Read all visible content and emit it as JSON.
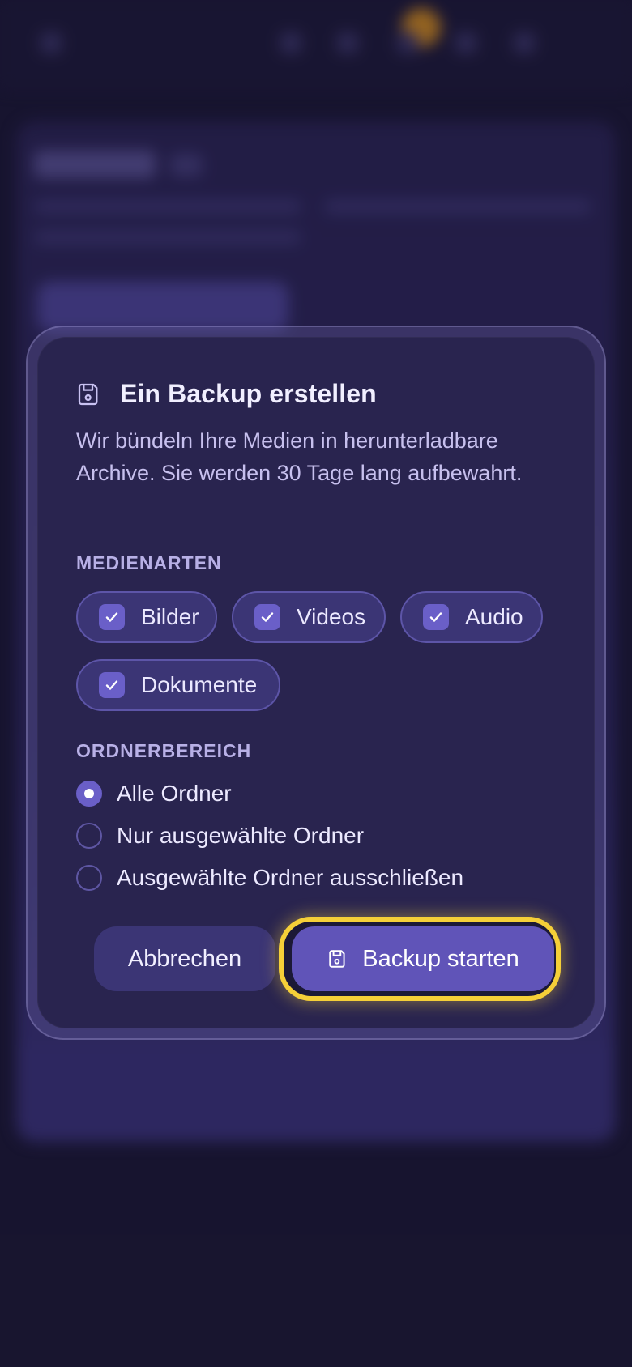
{
  "dialog": {
    "title": "Ein Backup erstellen",
    "title_icon": "save-disk-icon",
    "description": "Wir bündeln Ihre Medien in herunterladbare Archive. Sie werden 30 Tage lang aufbewahrt.",
    "media_section": {
      "label": "MEDIENARTEN",
      "options": [
        {
          "label": "Bilder",
          "checked": true
        },
        {
          "label": "Videos",
          "checked": true
        },
        {
          "label": "Audio",
          "checked": true
        },
        {
          "label": "Dokumente",
          "checked": true
        }
      ]
    },
    "folder_section": {
      "label": "ORDNERBEREICH",
      "options": [
        {
          "label": "Alle Ordner",
          "selected": true
        },
        {
          "label": "Nur ausgewählte Ordner",
          "selected": false
        },
        {
          "label": "Ausgewählte Ordner ausschließen",
          "selected": false
        }
      ]
    },
    "actions": {
      "cancel_label": "Abbrechen",
      "primary_label": "Backup starten",
      "primary_icon": "save-disk-icon",
      "highlight_color": "#f5cf38"
    }
  },
  "colors": {
    "backdrop": "#1b1834",
    "dialog_bg": "#29244f",
    "accent": "#6054b8",
    "checkbox": "#6a5fc8"
  }
}
